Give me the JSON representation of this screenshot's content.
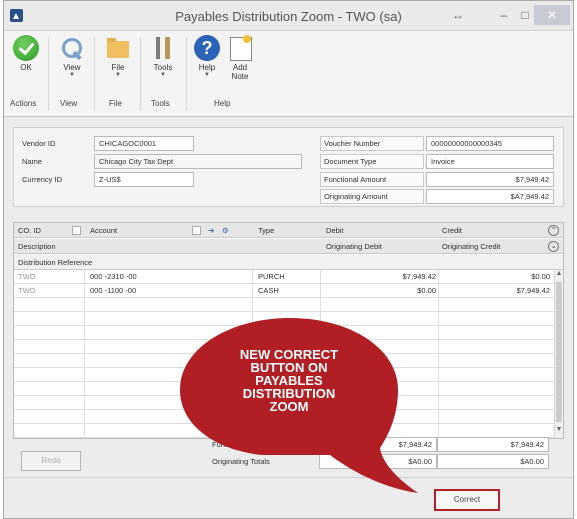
{
  "window": {
    "title": "Payables Distribution Zoom  -  TWO (sa)"
  },
  "ribbon": {
    "buttons": {
      "ok": "OK",
      "view": "View",
      "file": "File",
      "tools": "Tools",
      "help": "Help",
      "add_note_1": "Add",
      "add_note_2": "Note"
    },
    "groups": [
      "Actions",
      "View",
      "File",
      "Tools",
      "Help"
    ]
  },
  "header": {
    "vendor_id_label": "Vendor ID",
    "vendor_id": "CHICAGOC0001",
    "name_label": "Name",
    "name": "Chicago City Tax Dept",
    "currency_id_label": "Currency ID",
    "currency_id": "Z-US$",
    "voucher_number_label": "Voucher Number",
    "voucher_number": "00000000000000345",
    "document_type_label": "Document Type",
    "document_type": "Invoice",
    "functional_amount_label": "Functional Amount",
    "functional_amount": "$7,949.42",
    "originating_amount_label": "Originating Amount",
    "originating_amount": "$A7,949.42"
  },
  "grid": {
    "headers": {
      "co_id": "CO. ID",
      "account": "Account",
      "type": "Type",
      "debit": "Debit",
      "credit": "Credit",
      "description": "Description",
      "originating_debit": "Originating Debit",
      "originating_credit": "Originating Credit",
      "distribution_reference": "Distribution Reference"
    },
    "rows": [
      {
        "co_id": "TWO",
        "account": "000 -2310 -00",
        "type": "PURCH",
        "debit": "$7,949.42",
        "credit": "$0.00"
      },
      {
        "co_id": "TWO",
        "account": "000 -1100 -00",
        "type": "CASH",
        "debit": "$0.00",
        "credit": "$7,949.42"
      }
    ]
  },
  "totals": {
    "functional_label": "Functional Totals",
    "functional_debit": "$7,949.42",
    "functional_credit": "$7,949.42",
    "originating_label": "Originating Totals",
    "originating_debit": "$A0.00",
    "originating_credit": "$A0.00"
  },
  "buttons": {
    "redo": "Redo",
    "correct": "Correct"
  },
  "callout": {
    "line1": "NEW CORRECT",
    "line2": "BUTTON ON",
    "line3": "PAYABLES",
    "line4": "DISTRIBUTION",
    "line5": "ZOOM",
    "color": "#b11f24"
  }
}
